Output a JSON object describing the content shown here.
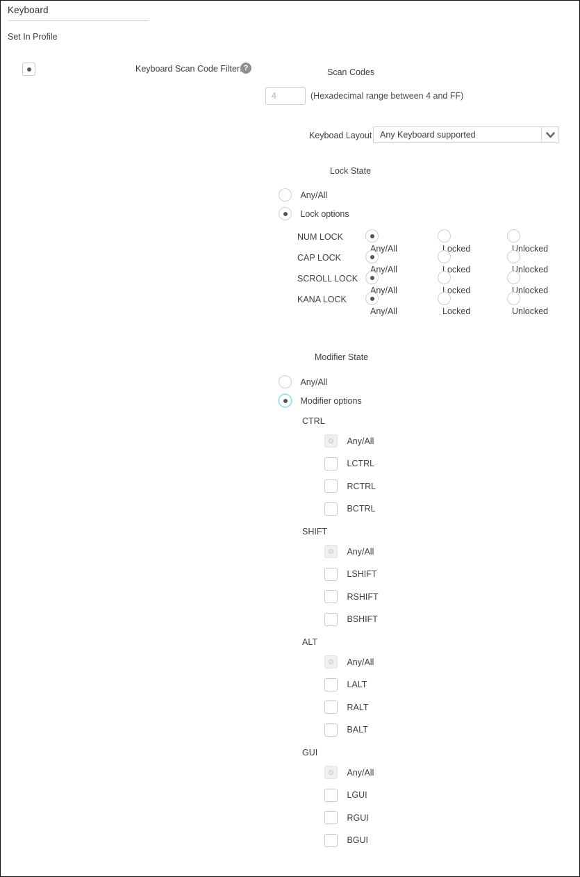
{
  "header": {
    "title": "Keyboard",
    "set_in_profile_label": "Set In Profile"
  },
  "scan_code_filter": {
    "label": "Keyboard Scan Code Filter:",
    "help_icon": "help-icon",
    "profile_checkbox_state": "checked",
    "scan_codes_heading": "Scan Codes",
    "hex_input_value": "",
    "hex_input_placeholder": "4",
    "hex_hint": "(Hexadecimal range between 4 and FF)"
  },
  "keyboard_layout": {
    "label": "Keyboad Layout",
    "selected": "Any Keyboard supported",
    "options": [
      "Any Keyboard supported"
    ],
    "arrow_icon": "chevron-down-icon"
  },
  "lock_state": {
    "heading": "Lock State",
    "mode_any_label": "Any/All",
    "mode_options_label": "Lock options",
    "mode_selected": "Lock options",
    "column_labels": [
      "Any/All",
      "Locked",
      "Unlocked"
    ],
    "rows": [
      {
        "name": "NUM LOCK",
        "selected": "Any/All"
      },
      {
        "name": "CAP LOCK",
        "selected": "Any/All"
      },
      {
        "name": "SCROLL LOCK",
        "selected": "Any/All"
      },
      {
        "name": "KANA LOCK",
        "selected": "Any/All"
      }
    ]
  },
  "modifier_state": {
    "heading": "Modifier State",
    "mode_any_label": "Any/All",
    "mode_options_label": "Modifier options",
    "mode_selected": "Modifier options",
    "groups": [
      {
        "title": "CTRL",
        "items": [
          {
            "label": "Any/All",
            "state": "checked-disabled"
          },
          {
            "label": "LCTRL",
            "state": "unchecked"
          },
          {
            "label": "RCTRL",
            "state": "unchecked"
          },
          {
            "label": "BCTRL",
            "state": "unchecked"
          }
        ]
      },
      {
        "title": "SHIFT",
        "items": [
          {
            "label": "Any/All",
            "state": "checked-disabled"
          },
          {
            "label": "LSHIFT",
            "state": "unchecked"
          },
          {
            "label": "RSHIFT",
            "state": "unchecked"
          },
          {
            "label": "BSHIFT",
            "state": "unchecked"
          }
        ]
      },
      {
        "title": "ALT",
        "items": [
          {
            "label": "Any/All",
            "state": "checked-disabled"
          },
          {
            "label": "LALT",
            "state": "unchecked"
          },
          {
            "label": "RALT",
            "state": "unchecked"
          },
          {
            "label": "BALT",
            "state": "unchecked"
          }
        ]
      },
      {
        "title": "GUI",
        "items": [
          {
            "label": "Any/All",
            "state": "checked-disabled"
          },
          {
            "label": "LGUI",
            "state": "unchecked"
          },
          {
            "label": "RGUI",
            "state": "unchecked"
          },
          {
            "label": "BGUI",
            "state": "unchecked"
          }
        ]
      }
    ]
  },
  "colors": {
    "text": "#3f3f3f",
    "border": "#cccccc",
    "focus_ring": "#8ed8ef",
    "help_icon_bg": "#8f8f8f",
    "placeholder": "#b4b4b4"
  }
}
